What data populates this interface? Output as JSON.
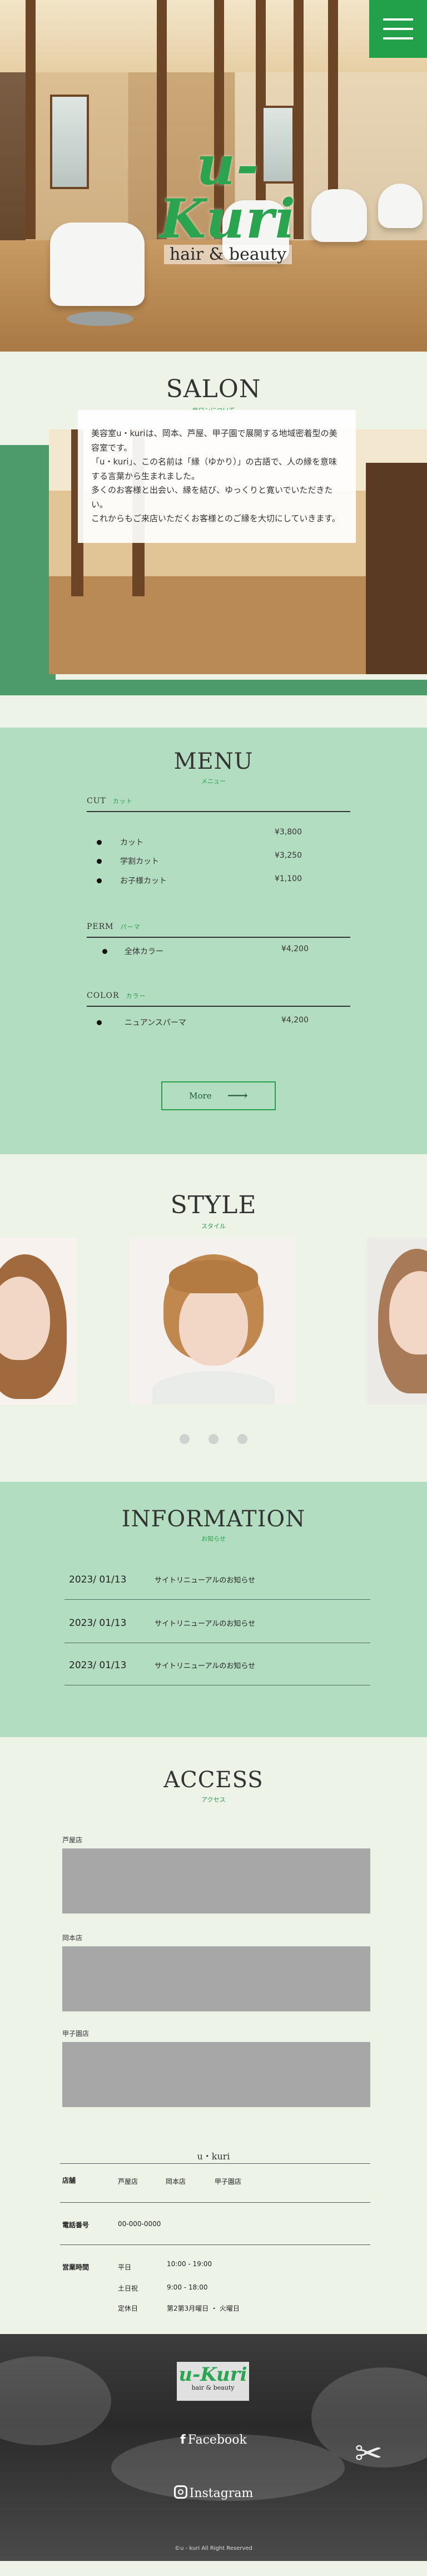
{
  "header": {
    "brand": "u-Kuri",
    "tagline": "hair & beauty"
  },
  "salon": {
    "title": "SALON",
    "subtitle": "サロンについて",
    "paragraphs": [
      "美容室u・kuriは、岡本、芦屋、甲子園で展開する地域密着型の美容室です。",
      "「u・kuri」、この名前は「縁（ゆかり）」の古語で、人の縁を意味する言葉から生まれました。",
      "多くのお客様と出会い、縁を結び、ゆっくりと寛いでいただきたい。",
      "これからもご来店いただくお客様とのご縁を大切にしていきます。"
    ]
  },
  "menu": {
    "title": "MENU",
    "subtitle": "メニュー",
    "categories": [
      {
        "name": "CUT",
        "jp": "カット",
        "items": [
          {
            "name": "カット",
            "price": "¥3,800"
          },
          {
            "name": "学割カット",
            "price": "¥3,250"
          },
          {
            "name": "お子様カット",
            "price": "¥1,100"
          }
        ]
      },
      {
        "name": "PERM",
        "jp": "パーマ",
        "items": [
          {
            "name": "全体カラー",
            "price": "¥4,200"
          }
        ]
      },
      {
        "name": "COLOR",
        "jp": "カラー",
        "items": [
          {
            "name": "ニュアンスパーマ",
            "price": "¥4,200"
          }
        ]
      }
    ],
    "more_label": "More",
    "more_arrow": "⟶"
  },
  "style": {
    "title": "STYLE",
    "subtitle": "スタイル",
    "dots": 3
  },
  "information": {
    "title": "INFORMATION",
    "subtitle": "お知らせ",
    "items": [
      {
        "date": "2023/ 01/13",
        "title": "サイトリニューアルのお知らせ"
      },
      {
        "date": "2023/ 01/13",
        "title": "サイトリニューアルのお知らせ"
      },
      {
        "date": "2023/ 01/13",
        "title": "サイトリニューアルのお知らせ"
      }
    ]
  },
  "access": {
    "title": "ACCESS",
    "subtitle": "アクセス",
    "maps": [
      "芦屋店",
      "岡本店",
      "甲子園店"
    ],
    "shop_name": "u・kuri",
    "store_label": "店舗",
    "stores": [
      "芦屋店",
      "岡本店",
      "甲子園店"
    ],
    "phone_label": "電話番号",
    "phone": "00-000-0000",
    "hours_label": "営業時間",
    "hours": [
      {
        "day": "平日",
        "time": "10:00 - 19:00"
      },
      {
        "day": "土日祝",
        "time": "9:00 - 18:00"
      },
      {
        "day": "定休日",
        "time": "第2第3月曜日 ・ 火曜日"
      }
    ]
  },
  "footer": {
    "brand": "u-Kuri",
    "tagline": "hair & beauty",
    "facebook_icon": "f",
    "facebook": "Facebook",
    "instagram": "Instagram",
    "copyright": "©u - kuri All Right Reserved"
  }
}
